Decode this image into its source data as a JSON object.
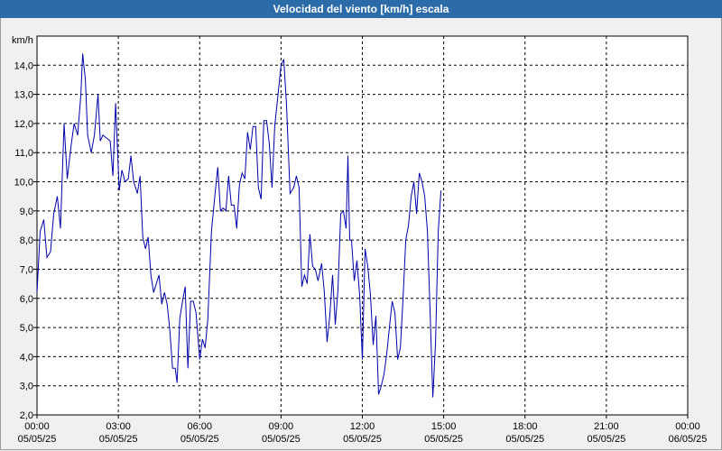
{
  "window": {
    "title": "Velocidad del viento [km/h] escala"
  },
  "chart_data": {
    "type": "line",
    "title": "Velocidad del viento [km/h] escala",
    "ylabel": "km/h",
    "ylim": [
      2.0,
      15.0
    ],
    "y_ticks": [
      "2,0",
      "3,0",
      "4,0",
      "5,0",
      "6,0",
      "7,0",
      "8,0",
      "9,0",
      "10,0",
      "11,0",
      "12,0",
      "13,0",
      "14,0"
    ],
    "x_ticks": [
      {
        "time": "00:00",
        "date": "05/05/25"
      },
      {
        "time": "03:00",
        "date": "05/05/25"
      },
      {
        "time": "06:00",
        "date": "05/05/25"
      },
      {
        "time": "09:00",
        "date": "05/05/25"
      },
      {
        "time": "12:00",
        "date": "05/05/25"
      },
      {
        "time": "15:00",
        "date": "05/05/25"
      },
      {
        "time": "18:00",
        "date": "05/05/25"
      },
      {
        "time": "21:00",
        "date": "05/05/25"
      },
      {
        "time": "00:00",
        "date": "06/05/25"
      }
    ],
    "grid": true,
    "series_color": "#0000aa",
    "series": [
      {
        "values": [
          [
            "00:00",
            6.2
          ],
          [
            "00:07",
            8.3
          ],
          [
            "00:15",
            8.7
          ],
          [
            "00:22",
            7.4
          ],
          [
            "00:30",
            7.6
          ],
          [
            "00:37",
            8.9
          ],
          [
            "00:45",
            9.5
          ],
          [
            "00:52",
            8.4
          ],
          [
            "01:00",
            12.0
          ],
          [
            "01:07",
            10.1
          ],
          [
            "01:15",
            11.2
          ],
          [
            "01:22",
            12.0
          ],
          [
            "01:30",
            11.6
          ],
          [
            "01:37",
            13.0
          ],
          [
            "01:41",
            14.4
          ],
          [
            "01:47",
            13.5
          ],
          [
            "01:52",
            11.6
          ],
          [
            "02:00",
            11.0
          ],
          [
            "02:07",
            11.6
          ],
          [
            "02:15",
            13.0
          ],
          [
            "02:20",
            11.4
          ],
          [
            "02:26",
            11.6
          ],
          [
            "02:34",
            11.5
          ],
          [
            "02:42",
            11.4
          ],
          [
            "02:48",
            10.2
          ],
          [
            "02:54",
            12.7
          ],
          [
            "03:02",
            9.7
          ],
          [
            "03:08",
            10.4
          ],
          [
            "03:15",
            10.0
          ],
          [
            "03:22",
            10.1
          ],
          [
            "03:28",
            10.9
          ],
          [
            "03:34",
            10.0
          ],
          [
            "03:42",
            9.6
          ],
          [
            "03:48",
            10.2
          ],
          [
            "03:54",
            8.1
          ],
          [
            "04:00",
            7.7
          ],
          [
            "04:06",
            8.1
          ],
          [
            "04:12",
            6.8
          ],
          [
            "04:18",
            6.2
          ],
          [
            "04:24",
            6.5
          ],
          [
            "04:30",
            6.8
          ],
          [
            "04:36",
            5.8
          ],
          [
            "04:42",
            6.2
          ],
          [
            "04:48",
            5.8
          ],
          [
            "04:54",
            4.9
          ],
          [
            "05:00",
            3.6
          ],
          [
            "05:06",
            3.6
          ],
          [
            "05:10",
            3.1
          ],
          [
            "05:16",
            5.3
          ],
          [
            "05:22",
            5.9
          ],
          [
            "05:28",
            6.4
          ],
          [
            "05:34",
            3.6
          ],
          [
            "05:40",
            5.9
          ],
          [
            "05:46",
            5.9
          ],
          [
            "05:52",
            5.5
          ],
          [
            "06:00",
            3.9
          ],
          [
            "06:06",
            4.6
          ],
          [
            "06:12",
            4.3
          ],
          [
            "06:18",
            5.3
          ],
          [
            "06:26",
            8.3
          ],
          [
            "06:34",
            9.6
          ],
          [
            "06:40",
            10.5
          ],
          [
            "06:46",
            9.0
          ],
          [
            "06:52",
            9.1
          ],
          [
            "06:58",
            9.0
          ],
          [
            "07:04",
            10.2
          ],
          [
            "07:10",
            9.2
          ],
          [
            "07:16",
            9.2
          ],
          [
            "07:22",
            8.4
          ],
          [
            "07:28",
            9.9
          ],
          [
            "07:34",
            10.3
          ],
          [
            "07:40",
            10.1
          ],
          [
            "07:46",
            11.7
          ],
          [
            "07:52",
            11.1
          ],
          [
            "07:58",
            11.9
          ],
          [
            "08:04",
            11.9
          ],
          [
            "08:10",
            9.8
          ],
          [
            "08:16",
            9.4
          ],
          [
            "08:22",
            12.1
          ],
          [
            "08:28",
            12.1
          ],
          [
            "08:34",
            11.3
          ],
          [
            "08:40",
            9.8
          ],
          [
            "08:46",
            11.9
          ],
          [
            "08:54",
            13.1
          ],
          [
            "09:00",
            14.0
          ],
          [
            "09:06",
            14.2
          ],
          [
            "09:12",
            12.7
          ],
          [
            "09:20",
            9.6
          ],
          [
            "09:28",
            9.8
          ],
          [
            "09:34",
            10.2
          ],
          [
            "09:40",
            9.8
          ],
          [
            "09:46",
            6.4
          ],
          [
            "09:52",
            6.8
          ],
          [
            "09:58",
            6.5
          ],
          [
            "10:04",
            8.2
          ],
          [
            "10:10",
            7.1
          ],
          [
            "10:16",
            7.0
          ],
          [
            "10:22",
            6.6
          ],
          [
            "10:30",
            7.2
          ],
          [
            "10:36",
            6.2
          ],
          [
            "10:42",
            4.5
          ],
          [
            "10:48",
            5.4
          ],
          [
            "10:54",
            6.8
          ],
          [
            "11:00",
            5.1
          ],
          [
            "11:06",
            6.3
          ],
          [
            "11:12",
            8.9
          ],
          [
            "11:18",
            9.0
          ],
          [
            "11:24",
            8.4
          ],
          [
            "11:28",
            10.9
          ],
          [
            "11:32",
            8.0
          ],
          [
            "11:36",
            8.0
          ],
          [
            "11:42",
            6.6
          ],
          [
            "11:48",
            7.3
          ],
          [
            "11:54",
            6.1
          ],
          [
            "12:00",
            3.9
          ],
          [
            "12:06",
            7.7
          ],
          [
            "12:12",
            7.1
          ],
          [
            "12:18",
            6.1
          ],
          [
            "12:24",
            4.4
          ],
          [
            "12:30",
            5.4
          ],
          [
            "12:36",
            2.7
          ],
          [
            "12:42",
            3.0
          ],
          [
            "12:48",
            3.4
          ],
          [
            "12:54",
            4.1
          ],
          [
            "13:00",
            5.0
          ],
          [
            "13:06",
            5.9
          ],
          [
            "13:12",
            5.5
          ],
          [
            "13:18",
            3.9
          ],
          [
            "13:24",
            4.3
          ],
          [
            "13:30",
            6.0
          ],
          [
            "13:36",
            8.0
          ],
          [
            "13:42",
            8.5
          ],
          [
            "13:48",
            9.5
          ],
          [
            "13:54",
            10.0
          ],
          [
            "14:00",
            8.9
          ],
          [
            "14:06",
            10.3
          ],
          [
            "14:12",
            10.0
          ],
          [
            "14:18",
            9.5
          ],
          [
            "14:24",
            8.3
          ],
          [
            "14:30",
            5.5
          ],
          [
            "14:36",
            2.6
          ],
          [
            "14:42",
            4.5
          ],
          [
            "14:48",
            8.3
          ],
          [
            "14:54",
            9.7
          ]
        ]
      }
    ]
  }
}
